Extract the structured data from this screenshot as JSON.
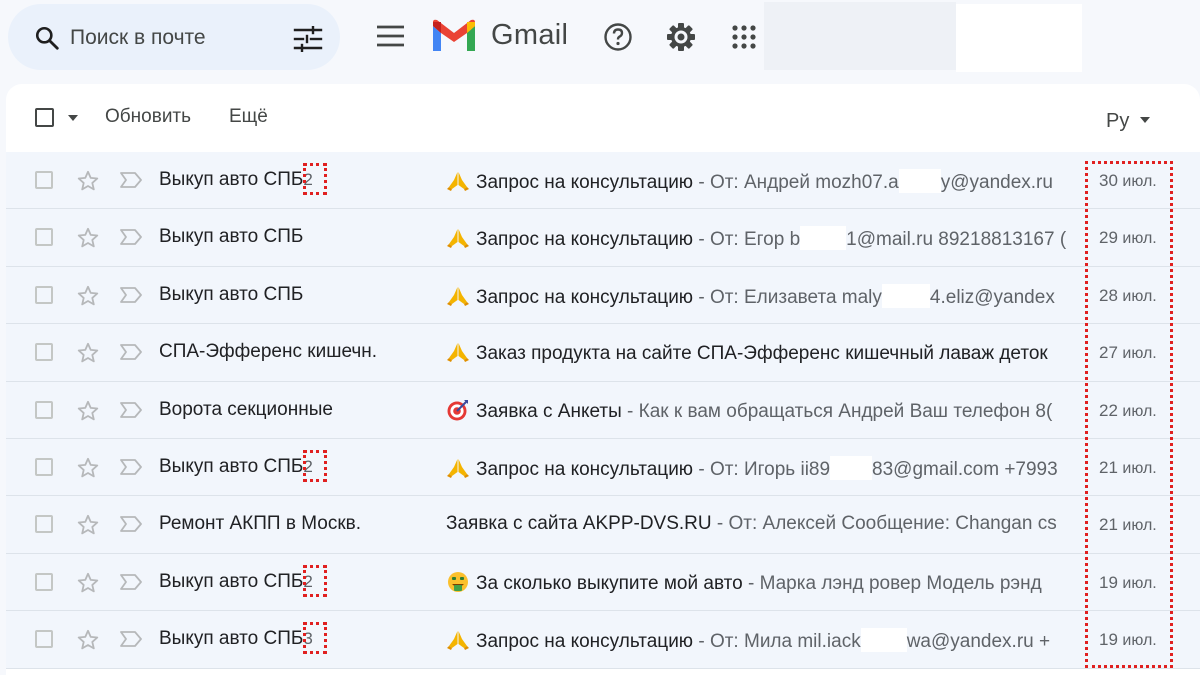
{
  "header": {
    "search_placeholder": "Поиск в почте",
    "app_name": "Gmail"
  },
  "toolbar": {
    "refresh_label": "Обновить",
    "more_label": "Ещё",
    "language_label": "Ру"
  },
  "emails": [
    {
      "sender": "Выкуп авто СПБ",
      "count": "2",
      "emoji": "pray",
      "subject": "Запрос на консультацию",
      "snippet_before": " - От: Андрей mozh07.a",
      "redact_w": 42,
      "snippet_after": "y@yandex.ru",
      "date_day": "30",
      "date_month": "июл."
    },
    {
      "sender": "Выкуп авто СПБ",
      "count": "",
      "emoji": "pray",
      "subject": "Запрос на консультацию",
      "snippet_before": " - От: Егор b",
      "redact_w": 46,
      "snippet_after": "1@mail.ru 89218813167 (",
      "date_day": "29",
      "date_month": "июл."
    },
    {
      "sender": "Выкуп авто СПБ",
      "count": "",
      "emoji": "pray",
      "subject": "Запрос на консультацию",
      "snippet_before": " - От: Елизавета maly",
      "redact_w": 48,
      "snippet_after": "4.eliz@yandex",
      "date_day": "28",
      "date_month": "июл."
    },
    {
      "sender": "СПА-Эфференс кишечн.",
      "count": "",
      "emoji": "pray",
      "subject": "Заказ продукта на сайте СПА-Эфференс кишечный лаваж деток",
      "snippet_before": "",
      "redact_w": 0,
      "snippet_after": "",
      "date_day": "27",
      "date_month": "июл."
    },
    {
      "sender": "Ворота секционные",
      "count": "",
      "emoji": "target",
      "subject": "Заявка с Анкеты",
      "snippet_before": " - Как к вам обращаться Андрей Ваш телефон 8(",
      "redact_w": 0,
      "snippet_after": "",
      "date_day": "22",
      "date_month": "июл."
    },
    {
      "sender": "Выкуп авто СПБ",
      "count": "2",
      "emoji": "pray",
      "subject": "Запрос на консультацию",
      "snippet_before": " - От: Игорь ii89",
      "redact_w": 42,
      "snippet_after": "83@gmail.com +7993",
      "date_day": "21",
      "date_month": "июл."
    },
    {
      "sender": "Ремонт АКПП в Москв.",
      "count": "",
      "emoji": "",
      "subject": "Заявка с сайта AKPP-DVS.RU",
      "snippet_before": " - От: Алексей Сообщение: Changan cs",
      "redact_w": 0,
      "snippet_after": "",
      "date_day": "21",
      "date_month": "июл."
    },
    {
      "sender": "Выкуп авто СПБ",
      "count": "2",
      "emoji": "money",
      "subject": "За сколько выкупите мой авто",
      "snippet_before": " - Марка лэнд ровер Модель рэнд",
      "redact_w": 0,
      "snippet_after": "",
      "date_day": "19",
      "date_month": "июл."
    },
    {
      "sender": "Выкуп авто СПБ",
      "count": "3",
      "emoji": "pray",
      "subject": "Запрос на консультацию",
      "snippet_before": " - От: Мила mil.iack",
      "redact_w": 46,
      "snippet_after": "wa@yandex.ru +",
      "date_day": "19",
      "date_month": "июл."
    }
  ],
  "colors": {
    "background": "#f6f8fc",
    "search_bg": "#eaf1fb",
    "row_bg": "#f2f6fc",
    "highlight": "#e02020"
  }
}
